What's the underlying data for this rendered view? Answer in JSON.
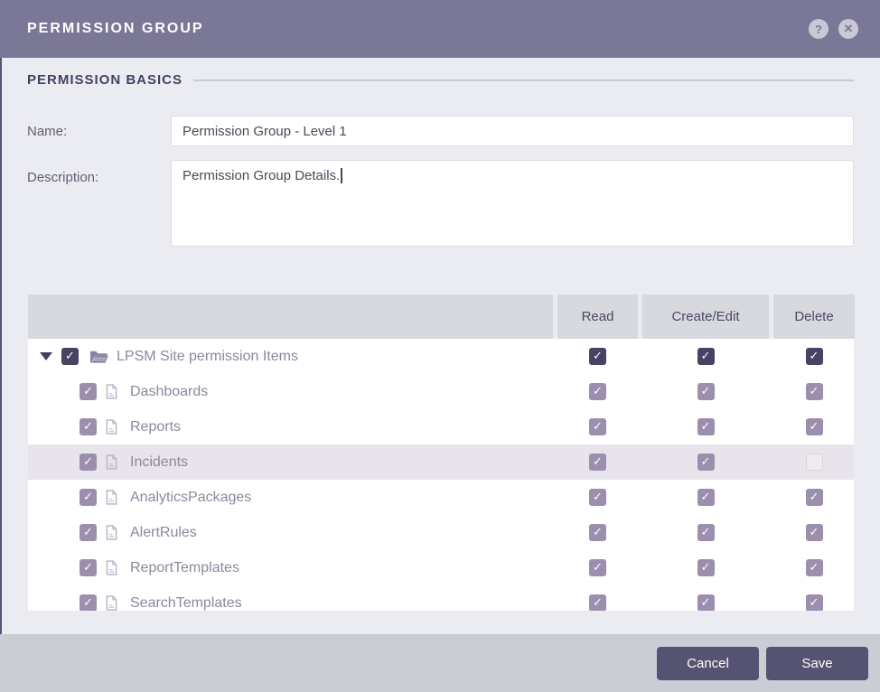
{
  "header": {
    "title": "PERMISSION GROUP",
    "help_glyph": "?",
    "close_glyph": "✕"
  },
  "section": {
    "title": "PERMISSION BASICS"
  },
  "form": {
    "name_label": "Name:",
    "name_value": "Permission Group - Level 1",
    "description_label": "Description:",
    "description_value": "Permission Group Details."
  },
  "table": {
    "columns": [
      "Read",
      "Create/Edit",
      "Delete"
    ],
    "check_glyph": "✓",
    "rows": [
      {
        "label": "LPSM Site permission Items",
        "type": "folder",
        "level": 0,
        "expanded": true,
        "checked": true,
        "read": true,
        "create_edit": true,
        "delete": true,
        "highlighted": false
      },
      {
        "label": "Dashboards",
        "type": "item",
        "level": 1,
        "checked": true,
        "read": true,
        "create_edit": true,
        "delete": true,
        "highlighted": false
      },
      {
        "label": "Reports",
        "type": "item",
        "level": 1,
        "checked": true,
        "read": true,
        "create_edit": true,
        "delete": true,
        "highlighted": false
      },
      {
        "label": "Incidents",
        "type": "item",
        "level": 1,
        "checked": true,
        "read": true,
        "create_edit": true,
        "delete": false,
        "highlighted": true
      },
      {
        "label": "AnalyticsPackages",
        "type": "item",
        "level": 1,
        "checked": true,
        "read": true,
        "create_edit": true,
        "delete": true,
        "highlighted": false
      },
      {
        "label": "AlertRules",
        "type": "item",
        "level": 1,
        "checked": true,
        "read": true,
        "create_edit": true,
        "delete": true,
        "highlighted": false
      },
      {
        "label": "ReportTemplates",
        "type": "item",
        "level": 1,
        "checked": true,
        "read": true,
        "create_edit": true,
        "delete": true,
        "highlighted": false
      },
      {
        "label": "SearchTemplates",
        "type": "item",
        "level": 1,
        "checked": true,
        "read": true,
        "create_edit": true,
        "delete": true,
        "highlighted": false
      }
    ]
  },
  "footer": {
    "cancel_label": "Cancel",
    "save_label": "Save"
  },
  "colors": {
    "titlebar_bg": "#7b7897",
    "body_bg": "#ebecf1",
    "table_header_bg": "#d8d9de",
    "checkbox_dark": "#474365",
    "checkbox_light": "#9c8fae",
    "highlight_row_bg": "#e8e4ec",
    "footer_bg": "#cbccd4",
    "button_bg": "#565372",
    "section_title_color": "#454163",
    "tree_text_color": "#8d889c"
  }
}
